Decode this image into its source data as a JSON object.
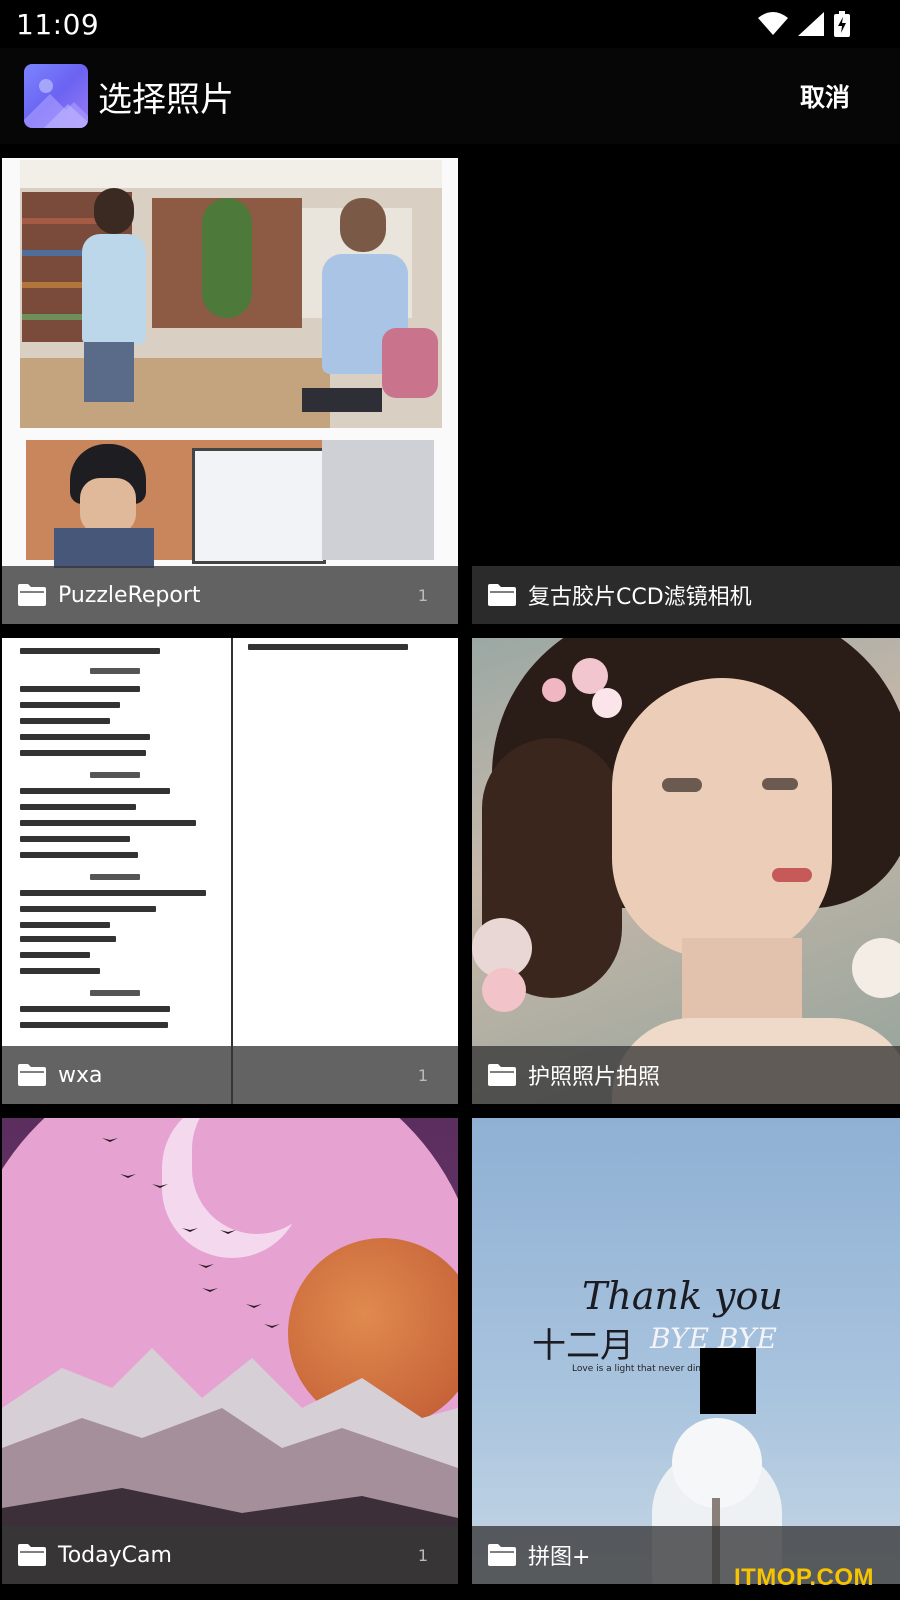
{
  "status_bar": {
    "time": "11:09",
    "icons": [
      "wifi-icon",
      "signal-icon",
      "battery-charging-icon"
    ]
  },
  "app_bar": {
    "logo_icon": "photo-mountain-icon",
    "title": "选择照片",
    "cancel_label": "取消"
  },
  "albums": [
    {
      "name": "PuzzleReport",
      "count": "1",
      "thumbnail": "library-photo"
    },
    {
      "name": "复古胶片CCD滤镜相机",
      "count": "",
      "thumbnail": "black"
    },
    {
      "name": "wxa",
      "count": "1",
      "thumbnail": "vocabulary-document"
    },
    {
      "name": "护照照片拍照",
      "count": "",
      "thumbnail": "painted-portrait"
    },
    {
      "name": "TodayCam",
      "count": "1",
      "thumbnail": "pink-moon-mountains"
    },
    {
      "name": "拼图+",
      "count": "",
      "thumbnail": "thank-you-december"
    }
  ],
  "thumbnail_text": {
    "thank_you": "Thank you",
    "december": "十二月",
    "bye": "BYE BYE",
    "tagline": "Love is a light that never dims"
  },
  "watermark": "ITMOP.COM"
}
